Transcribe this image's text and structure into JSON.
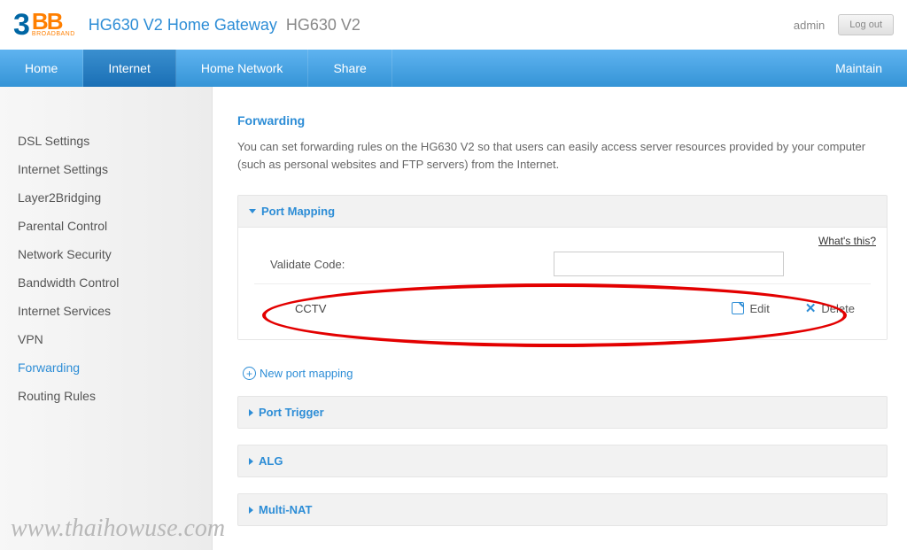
{
  "header": {
    "logo_num": "3",
    "logo_bb": "BB",
    "logo_sub": "BROADBAND",
    "title": "HG630 V2 Home Gateway",
    "model": "HG630 V2",
    "user": "admin",
    "logout": "Log out"
  },
  "nav": {
    "items": [
      "Home",
      "Internet",
      "Home Network",
      "Share",
      "Maintain"
    ],
    "active_index": 1
  },
  "sidebar": {
    "items": [
      "DSL Settings",
      "Internet Settings",
      "Layer2Bridging",
      "Parental Control",
      "Network Security",
      "Bandwidth Control",
      "Internet Services",
      "VPN",
      "Forwarding",
      "Routing Rules"
    ],
    "active_index": 8
  },
  "main": {
    "title": "Forwarding",
    "description": "You can set forwarding rules on the HG630 V2 so that users can easily access server resources provided by your computer (such as personal websites and FTP servers) from the Internet.",
    "whats_this": "What's this?",
    "port_mapping": {
      "title": "Port Mapping",
      "validate_label": "Validate Code:",
      "entries": [
        {
          "name": "CCTV"
        }
      ],
      "edit_label": "Edit",
      "delete_label": "Delete",
      "new_label": "New port mapping"
    },
    "panels": [
      {
        "title": "Port Trigger"
      },
      {
        "title": "ALG"
      },
      {
        "title": "Multi-NAT"
      }
    ]
  },
  "watermark": "www.thaihowuse.com"
}
